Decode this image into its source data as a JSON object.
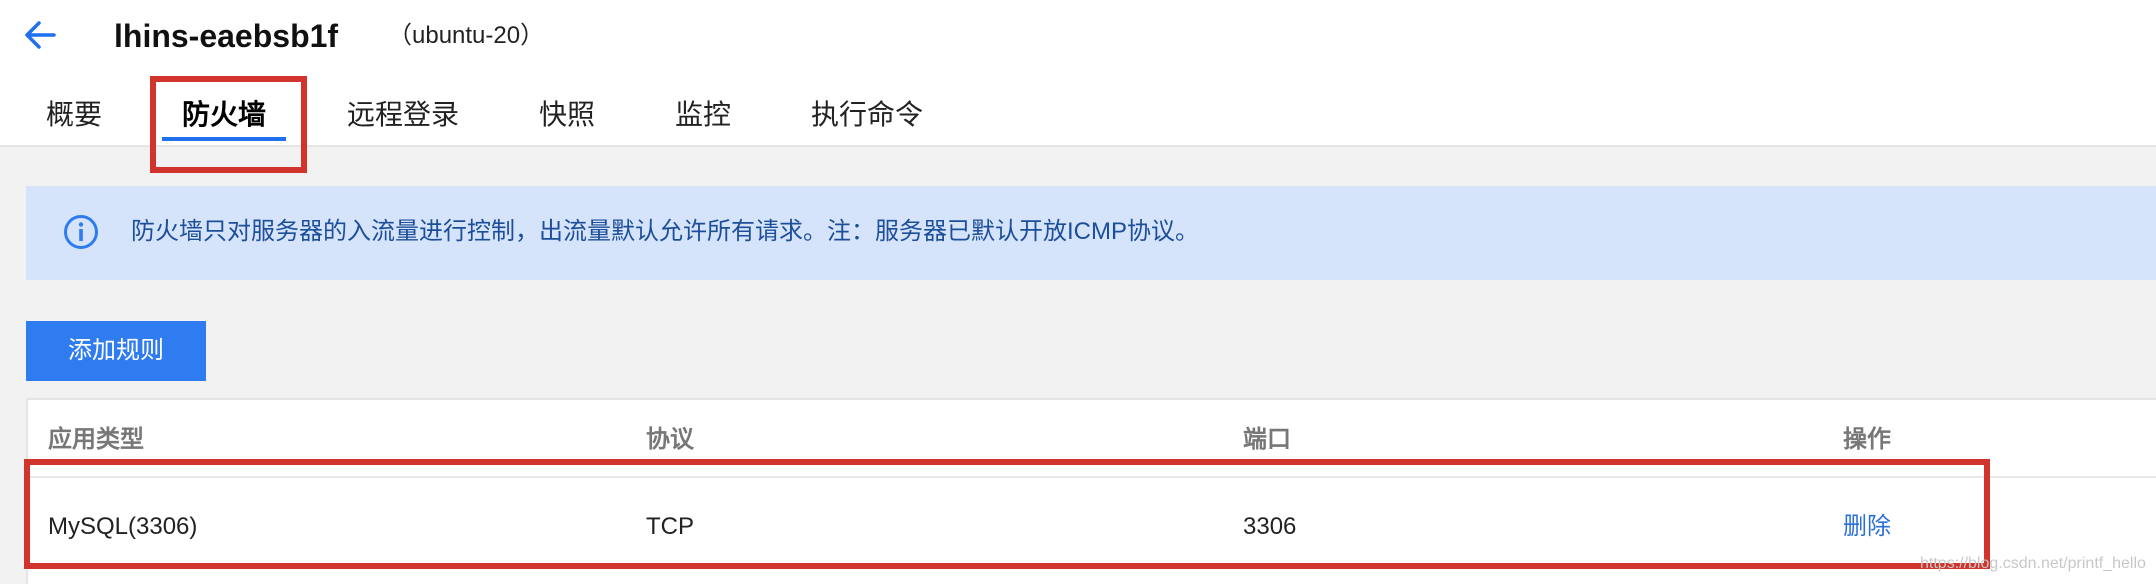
{
  "header": {
    "title": "lhins-eaebsb1f",
    "subtitle": "（ubuntu-20）",
    "back_icon": "arrow-left-icon"
  },
  "tabs": [
    {
      "label": "概要",
      "active": false
    },
    {
      "label": "防火墙",
      "active": true
    },
    {
      "label": "远程登录",
      "active": false
    },
    {
      "label": "快照",
      "active": false
    },
    {
      "label": "监控",
      "active": false
    },
    {
      "label": "执行命令",
      "active": false
    }
  ],
  "notice": {
    "icon": "info-icon",
    "text": "防火墙只对服务器的入流量进行控制，出流量默认允许所有请求。注：服务器已默认开放ICMP协议。"
  },
  "toolbar": {
    "add_rule_label": "添加规则"
  },
  "table": {
    "columns": [
      "应用类型",
      "协议",
      "端口",
      "操作"
    ],
    "rows": [
      {
        "app_type": "MySQL(3306)",
        "protocol": "TCP",
        "port": "3306",
        "action": "删除"
      }
    ]
  },
  "watermark": "https://blog.csdn.net/printf_hello",
  "colors": {
    "accent": "#2f7bf0",
    "highlight": "#d0342c",
    "notice_bg": "#d5e4fb"
  }
}
